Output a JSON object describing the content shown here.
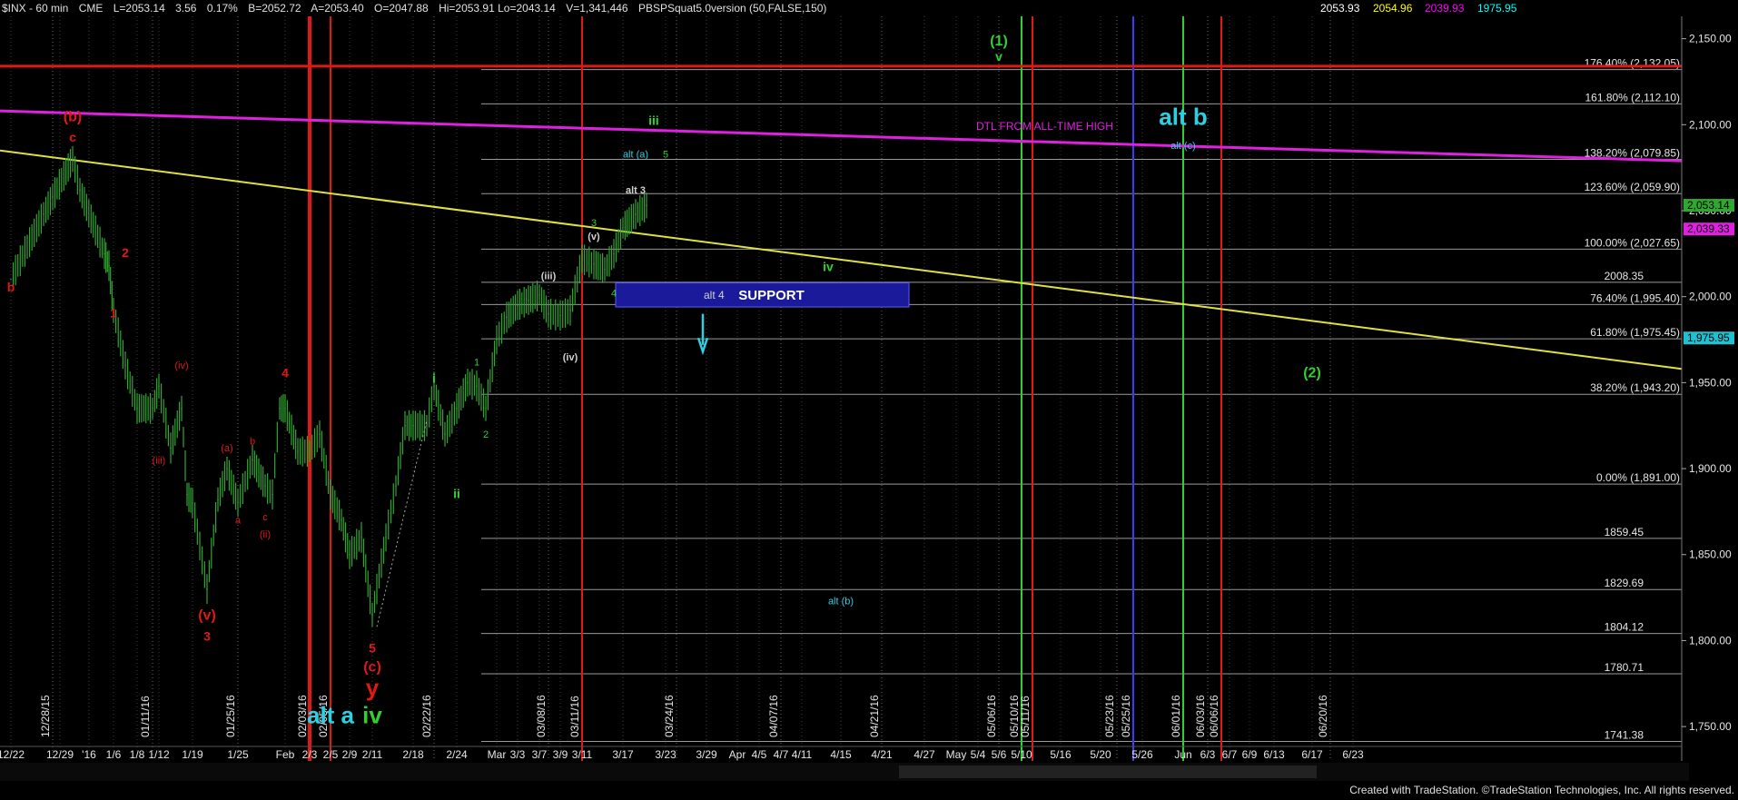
{
  "header": {
    "symbol": "$INX - 60 min",
    "exchange": "CME",
    "last": "L=2053.14",
    "change": "3.56",
    "change_pct": "0.17%",
    "bid": "B=2052.72",
    "ask": "A=2053.40",
    "open": "O=2047.88",
    "high_low": "Hi=2053.91  Lo=2043.14",
    "volume": "V=1,341,446",
    "study": "PBSPSquat5.0version (50,FALSE,150)",
    "study_values": [
      {
        "text": "2053.93",
        "color": "#ffffff"
      },
      {
        "text": "2054.96",
        "color": "#ffff00"
      },
      {
        "text": "2039.93",
        "color": "#ff00ff"
      },
      {
        "text": "1975.95",
        "color": "#00ffff"
      }
    ]
  },
  "footer": {
    "credit": "Created with TradeStation. ©TradeStation Technologies, Inc. All rights reserved."
  },
  "colors": {
    "background": "#000000",
    "candle": "#2fa82f",
    "red": "#e01818",
    "green": "#30d030",
    "cyan": "#2ecfe0",
    "magenta": "#e020e0",
    "yellow": "#e0e040",
    "support_box": "#1a1a9a"
  },
  "chart_data": {
    "type": "candlestick",
    "title": "",
    "xlabel": "",
    "ylabel": "",
    "ylim": [
      1730,
      2163
    ],
    "y_ticks": [
      "1,750.00",
      "1,800.00",
      "1,850.00",
      "1,900.00",
      "1,950.00",
      "2,000.00",
      "2,050.00",
      "2,100.00",
      "2,150.00"
    ],
    "x_ticks": [
      "12/22",
      "12/29",
      "'16",
      "1/6",
      "1/8",
      "1/12",
      "1/19",
      "1/25",
      "Feb",
      "2/3",
      "2/5",
      "2/9",
      "2/11",
      "2/18",
      "2/24",
      "Mar",
      "3/3",
      "3/7",
      "3/9",
      "3/11",
      "3/17",
      "3/23",
      "3/29",
      "Apr",
      "4/5",
      "4/7",
      "4/11",
      "4/15",
      "4/21",
      "4/27",
      "May",
      "5/4",
      "5/6",
      "5/10",
      "5/16",
      "5/20",
      "5/26",
      "Jun",
      "6/3",
      "6/7",
      "6/9",
      "6/13",
      "6/17",
      "6/23"
    ],
    "series": [
      {
        "type": "price",
        "x": [
          "12/22",
          "12/24",
          "12/28",
          "12/29",
          "12/30",
          "1/4",
          "1/5",
          "1/6",
          "1/7",
          "1/8",
          "1/11",
          "1/12",
          "1/13",
          "1/14",
          "1/15",
          "1/19",
          "1/20",
          "1/21",
          "1/22",
          "1/25",
          "1/26",
          "1/27",
          "1/28",
          "1/29",
          "2/1",
          "2/2",
          "2/3",
          "2/4",
          "2/5",
          "2/8",
          "2/9",
          "2/10",
          "2/11",
          "2/12",
          "2/16",
          "2/17",
          "2/18",
          "2/19",
          "2/22",
          "2/23",
          "2/24",
          "2/25",
          "2/26",
          "2/29",
          "3/1",
          "3/2",
          "3/3",
          "3/4",
          "3/7",
          "3/8",
          "3/9",
          "3/10",
          "3/11",
          "3/14",
          "3/15",
          "3/16",
          "3/17",
          "3/18",
          "3/21"
        ],
        "values": [
          2010,
          2048,
          2058,
          2080,
          2062,
          2025,
          2018,
          1992,
          1960,
          1935,
          1935,
          1948,
          1912,
          1935,
          1885,
          1880,
          1830,
          1882,
          1900,
          1880,
          1905,
          1890,
          1885,
          1935,
          1935,
          1910,
          1910,
          1920,
          1885,
          1870,
          1850,
          1860,
          1815,
          1860,
          1890,
          1925,
          1925,
          1925,
          1948,
          1920,
          1935,
          1950,
          1948,
          1935,
          1975,
          1988,
          1995,
          1998,
          2001,
          1990,
          1989,
          1992,
          2022,
          2019,
          2016,
          2025,
          2040,
          2048,
          2053
        ]
      },
      {
        "type": "hline",
        "name": "fib_levels",
        "values": [
          2132.05,
          2112.1,
          2079.85,
          2059.9,
          2027.65,
          1995.4,
          1975.45,
          1943.2,
          1891.0
        ],
        "labels": [
          "176.40% (2,132.05)",
          "161.80% (2,112.10)",
          "138.20% (2,079.85)",
          "123.60% (2,059.90)",
          "100.00% (2,027.65)",
          "76.40% (1,995.40)",
          "61.80% (1,975.45)",
          "38.20% (1,943.20)",
          "0.00% (1,891.00)"
        ]
      },
      {
        "type": "hline",
        "name": "pivot_levels",
        "values": [
          2008.35,
          1859.45,
          1829.69,
          1804.12,
          1780.71,
          1741.38
        ],
        "labels": [
          "2008.35",
          "1859.45",
          "1829.69",
          "1804.12",
          "1780.71",
          "1741.38"
        ]
      },
      {
        "type": "trendline",
        "name": "DTL FROM ALL-TIME HIGH",
        "x": [
          "12/22",
          "6/23"
        ],
        "values": [
          2108,
          2079
        ]
      },
      {
        "type": "trendline",
        "name": "yellow_trendline",
        "x": [
          "12/22",
          "6/23"
        ],
        "values": [
          2085,
          1958
        ]
      },
      {
        "type": "box",
        "name": "SUPPORT",
        "x": [
          "3/17",
          "4/21"
        ],
        "values": [
          1994,
          2008
        ],
        "inner_label": "alt 4"
      }
    ],
    "vertical_date_labels": [
      {
        "text": "12/28/15",
        "x": "12/28"
      },
      {
        "text": "01/11/16",
        "x": "1/11"
      },
      {
        "text": "01/25/16",
        "x": "1/25"
      },
      {
        "text": "02/03/16",
        "x": "2/3",
        "color": "#e01818"
      },
      {
        "text": "02/05/16",
        "x": "2/5",
        "color": "#e01818"
      },
      {
        "text": "02/22/16",
        "x": "2/22"
      },
      {
        "text": "03/08/16",
        "x": "3/8"
      },
      {
        "text": "03/11/16",
        "x": "3/11",
        "color": "#e01818"
      },
      {
        "text": "03/24/16",
        "x": "3/24"
      },
      {
        "text": "04/07/16",
        "x": "4/7"
      },
      {
        "text": "04/21/16",
        "x": "4/21"
      },
      {
        "text": "05/06/16",
        "x": "5/6"
      },
      {
        "text": "05/10/16",
        "x": "5/10",
        "color": "#30d030"
      },
      {
        "text": "05/11/16",
        "x": "5/11",
        "color": "#e01818"
      },
      {
        "text": "05/23/16",
        "x": "5/23"
      },
      {
        "text": "05/25/16",
        "x": "5/25",
        "color": "#3a3aff"
      },
      {
        "text": "06/01/16",
        "x": "6/1",
        "color": "#30d030"
      },
      {
        "text": "06/03/16",
        "x": "6/3"
      },
      {
        "text": "06/06/16",
        "x": "6/6",
        "color": "#e01818"
      },
      {
        "text": "06/20/16",
        "x": "6/20"
      }
    ],
    "price_tags": [
      {
        "text": "2,053.14",
        "value": 2053.14,
        "bg": "#2fa82f"
      },
      {
        "text": "2,039.33",
        "value": 2039.33,
        "bg": "#e020e0"
      },
      {
        "text": "1,975.95",
        "value": 1975.95,
        "bg": "#20c0d0"
      }
    ],
    "annotations": [
      {
        "text": "(b)",
        "x": "12/29",
        "y": 2102,
        "color": "red",
        "size": "l"
      },
      {
        "text": "c",
        "x": "12/29",
        "y": 2090,
        "color": "red",
        "size": "m"
      },
      {
        "text": "b",
        "x": "12/22",
        "y": 2003,
        "color": "red",
        "size": "m"
      },
      {
        "text": "1",
        "x": "1/6",
        "y": 1988,
        "color": "red",
        "size": "m"
      },
      {
        "text": "2",
        "x": "1/7",
        "y": 2023,
        "color": "red",
        "size": "m"
      },
      {
        "text": "(iii)",
        "x": "1/12",
        "y": 1903,
        "color": "red",
        "size": "s"
      },
      {
        "text": "(iv)",
        "x": "1/14",
        "y": 1958,
        "color": "red",
        "size": "s"
      },
      {
        "text": "(v)",
        "x": "1/20",
        "y": 1812,
        "color": "red",
        "size": "l"
      },
      {
        "text": "3",
        "x": "1/20",
        "y": 1800,
        "color": "red",
        "size": "m"
      },
      {
        "text": "(a)",
        "x": "1/22",
        "y": 1910,
        "color": "red",
        "size": "s"
      },
      {
        "text": "b",
        "x": "1/26",
        "y": 1914,
        "color": "red",
        "size": "s"
      },
      {
        "text": "a",
        "x": "1/25",
        "y": 1868,
        "color": "red",
        "size": "s"
      },
      {
        "text": "c",
        "x": "1/27",
        "y": 1870,
        "color": "red",
        "size": "s"
      },
      {
        "text": "(ii)",
        "x": "1/27",
        "y": 1860,
        "color": "red",
        "size": "s"
      },
      {
        "text": "4",
        "x": "2/1",
        "y": 1953,
        "color": "red",
        "size": "m"
      },
      {
        "text": "5",
        "x": "2/11",
        "y": 1793,
        "color": "red",
        "size": "m"
      },
      {
        "text": "(c)",
        "x": "2/11",
        "y": 1782,
        "color": "red",
        "size": "l"
      },
      {
        "text": "y",
        "x": "2/11",
        "y": 1768,
        "color": "red",
        "size": "xl"
      },
      {
        "text": "alt a",
        "x": "2/5",
        "y": 1752,
        "color": "cyan",
        "size": "xl"
      },
      {
        "text": "iv",
        "x": "2/11",
        "y": 1752,
        "color": "green",
        "size": "xl"
      },
      {
        "text": "i",
        "x": "2/22",
        "y": 1950,
        "color": "green",
        "size": "m"
      },
      {
        "text": "ii",
        "x": "2/24",
        "y": 1883,
        "color": "green",
        "size": "m"
      },
      {
        "text": "1",
        "x": "2/26",
        "y": 1960,
        "color": "green",
        "size": "s"
      },
      {
        "text": "2",
        "x": "2/29",
        "y": 1918,
        "color": "green",
        "size": "s"
      },
      {
        "text": "(iii)",
        "x": "3/8",
        "y": 2010,
        "color": "grey",
        "size": "s"
      },
      {
        "text": "(iv)",
        "x": "3/10",
        "y": 1963,
        "color": "grey",
        "size": "s"
      },
      {
        "text": "(v)",
        "x": "3/14",
        "y": 2033,
        "color": "grey",
        "size": "s"
      },
      {
        "text": "3",
        "x": "3/14",
        "y": 2041,
        "color": "green",
        "size": "s"
      },
      {
        "text": "4",
        "x": "3/16",
        "y": 2000,
        "color": "green",
        "size": "s"
      },
      {
        "text": "alt 3",
        "x": "3/18",
        "y": 2060,
        "color": "grey",
        "size": "s"
      },
      {
        "text": "iii",
        "x": "3/22",
        "y": 2100,
        "color": "green",
        "size": "m"
      },
      {
        "text": "alt (a)",
        "x": "3/18",
        "y": 2081,
        "color": "cyan",
        "size": "s"
      },
      {
        "text": "5",
        "x": "3/23",
        "y": 2081,
        "color": "green",
        "size": "s"
      },
      {
        "text": "iv",
        "x": "4/14",
        "y": 2015,
        "color": "green",
        "size": "m"
      },
      {
        "text": "(1)",
        "x": "5/6",
        "y": 2146,
        "color": "green",
        "size": "l"
      },
      {
        "text": "v",
        "x": "5/6",
        "y": 2137,
        "color": "green",
        "size": "m"
      },
      {
        "text": "alt b",
        "x": "6/1",
        "y": 2100,
        "color": "cyan",
        "size": "xl"
      },
      {
        "text": "alt (c)",
        "x": "6/1",
        "y": 2086,
        "color": "cyan",
        "size": "s"
      },
      {
        "text": "alt (b)",
        "x": "4/15",
        "y": 1821,
        "color": "cyan",
        "size": "s"
      },
      {
        "text": "(2)",
        "x": "6/17",
        "y": 1953,
        "color": "green",
        "size": "l"
      }
    ]
  }
}
